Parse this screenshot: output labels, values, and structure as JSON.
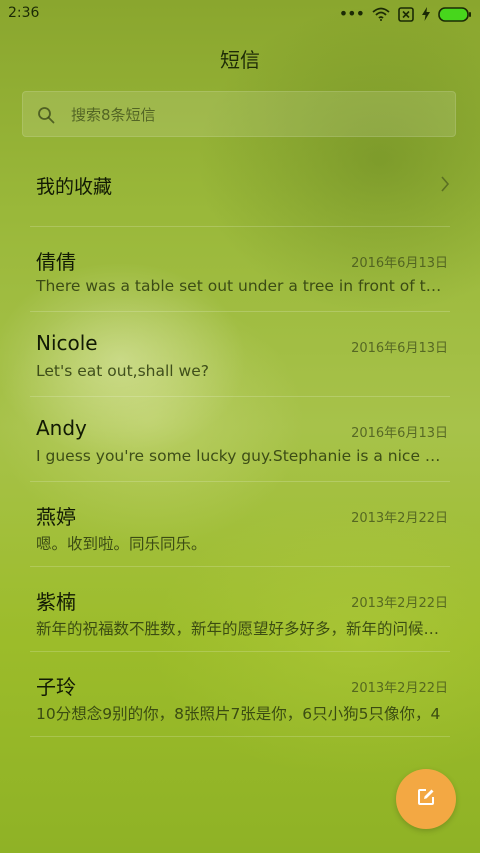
{
  "status_bar": {
    "time": "2:36",
    "dots": "•••",
    "icons": [
      "wifi-icon",
      "sim-x-icon",
      "charging-icon",
      "battery-icon"
    ],
    "battery_color": "#47d61c"
  },
  "header": {
    "title": "短信"
  },
  "search": {
    "placeholder": "搜索8条短信"
  },
  "favorites": {
    "label": "我的收藏"
  },
  "messages": [
    {
      "name": "倩倩",
      "date": "2016年6月13日",
      "preview": "There was a table set out under a tree in front of the house"
    },
    {
      "name": "Nicole",
      "date": "2016年6月13日",
      "preview": "Let's eat out,shall we?"
    },
    {
      "name": "Andy",
      "date": "2016年6月13日",
      "preview": "I guess you're some lucky guy.Stephanie is a nice girl."
    },
    {
      "name": "燕婷",
      "date": "2013年2月22日",
      "preview": "嗯。收到啦。同乐同乐。"
    },
    {
      "name": "紫楠",
      "date": "2013年2月22日",
      "preview": "新年的祝福数不胜数，新年的愿望好多好多，新年的问候送给你"
    },
    {
      "name": "子玲",
      "date": "2013年2月22日",
      "preview": "10分想念9别的你，8张照片7张是你，6只小狗5只像你，4"
    }
  ],
  "fab": {
    "icon": "compose-icon",
    "color": "#f3a843"
  }
}
